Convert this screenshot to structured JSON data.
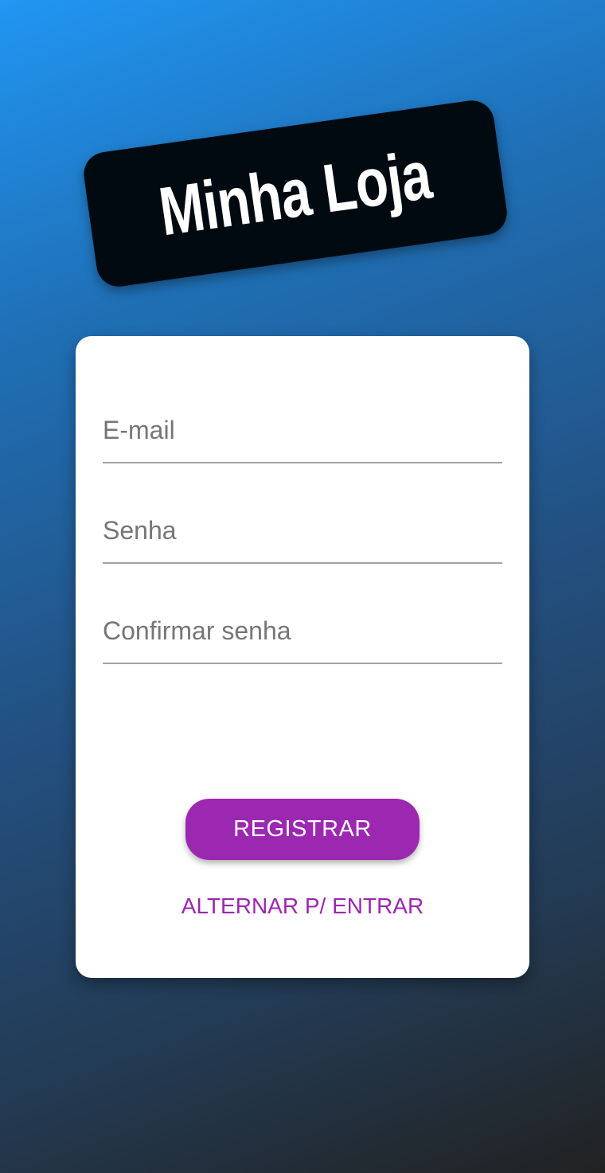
{
  "header": {
    "title": "Minha Loja"
  },
  "form": {
    "email": {
      "placeholder": "E-mail",
      "value": ""
    },
    "password": {
      "placeholder": "Senha",
      "value": ""
    },
    "confirm_password": {
      "placeholder": "Confirmar senha",
      "value": ""
    },
    "submit_label": "REGISTRAR",
    "toggle_label": "ALTERNAR P/ ENTRAR"
  },
  "colors": {
    "accent": "#9c27b0",
    "title_badge": "#020a11",
    "gradient_start": "#2196f3",
    "gradient_end": "#222222"
  }
}
